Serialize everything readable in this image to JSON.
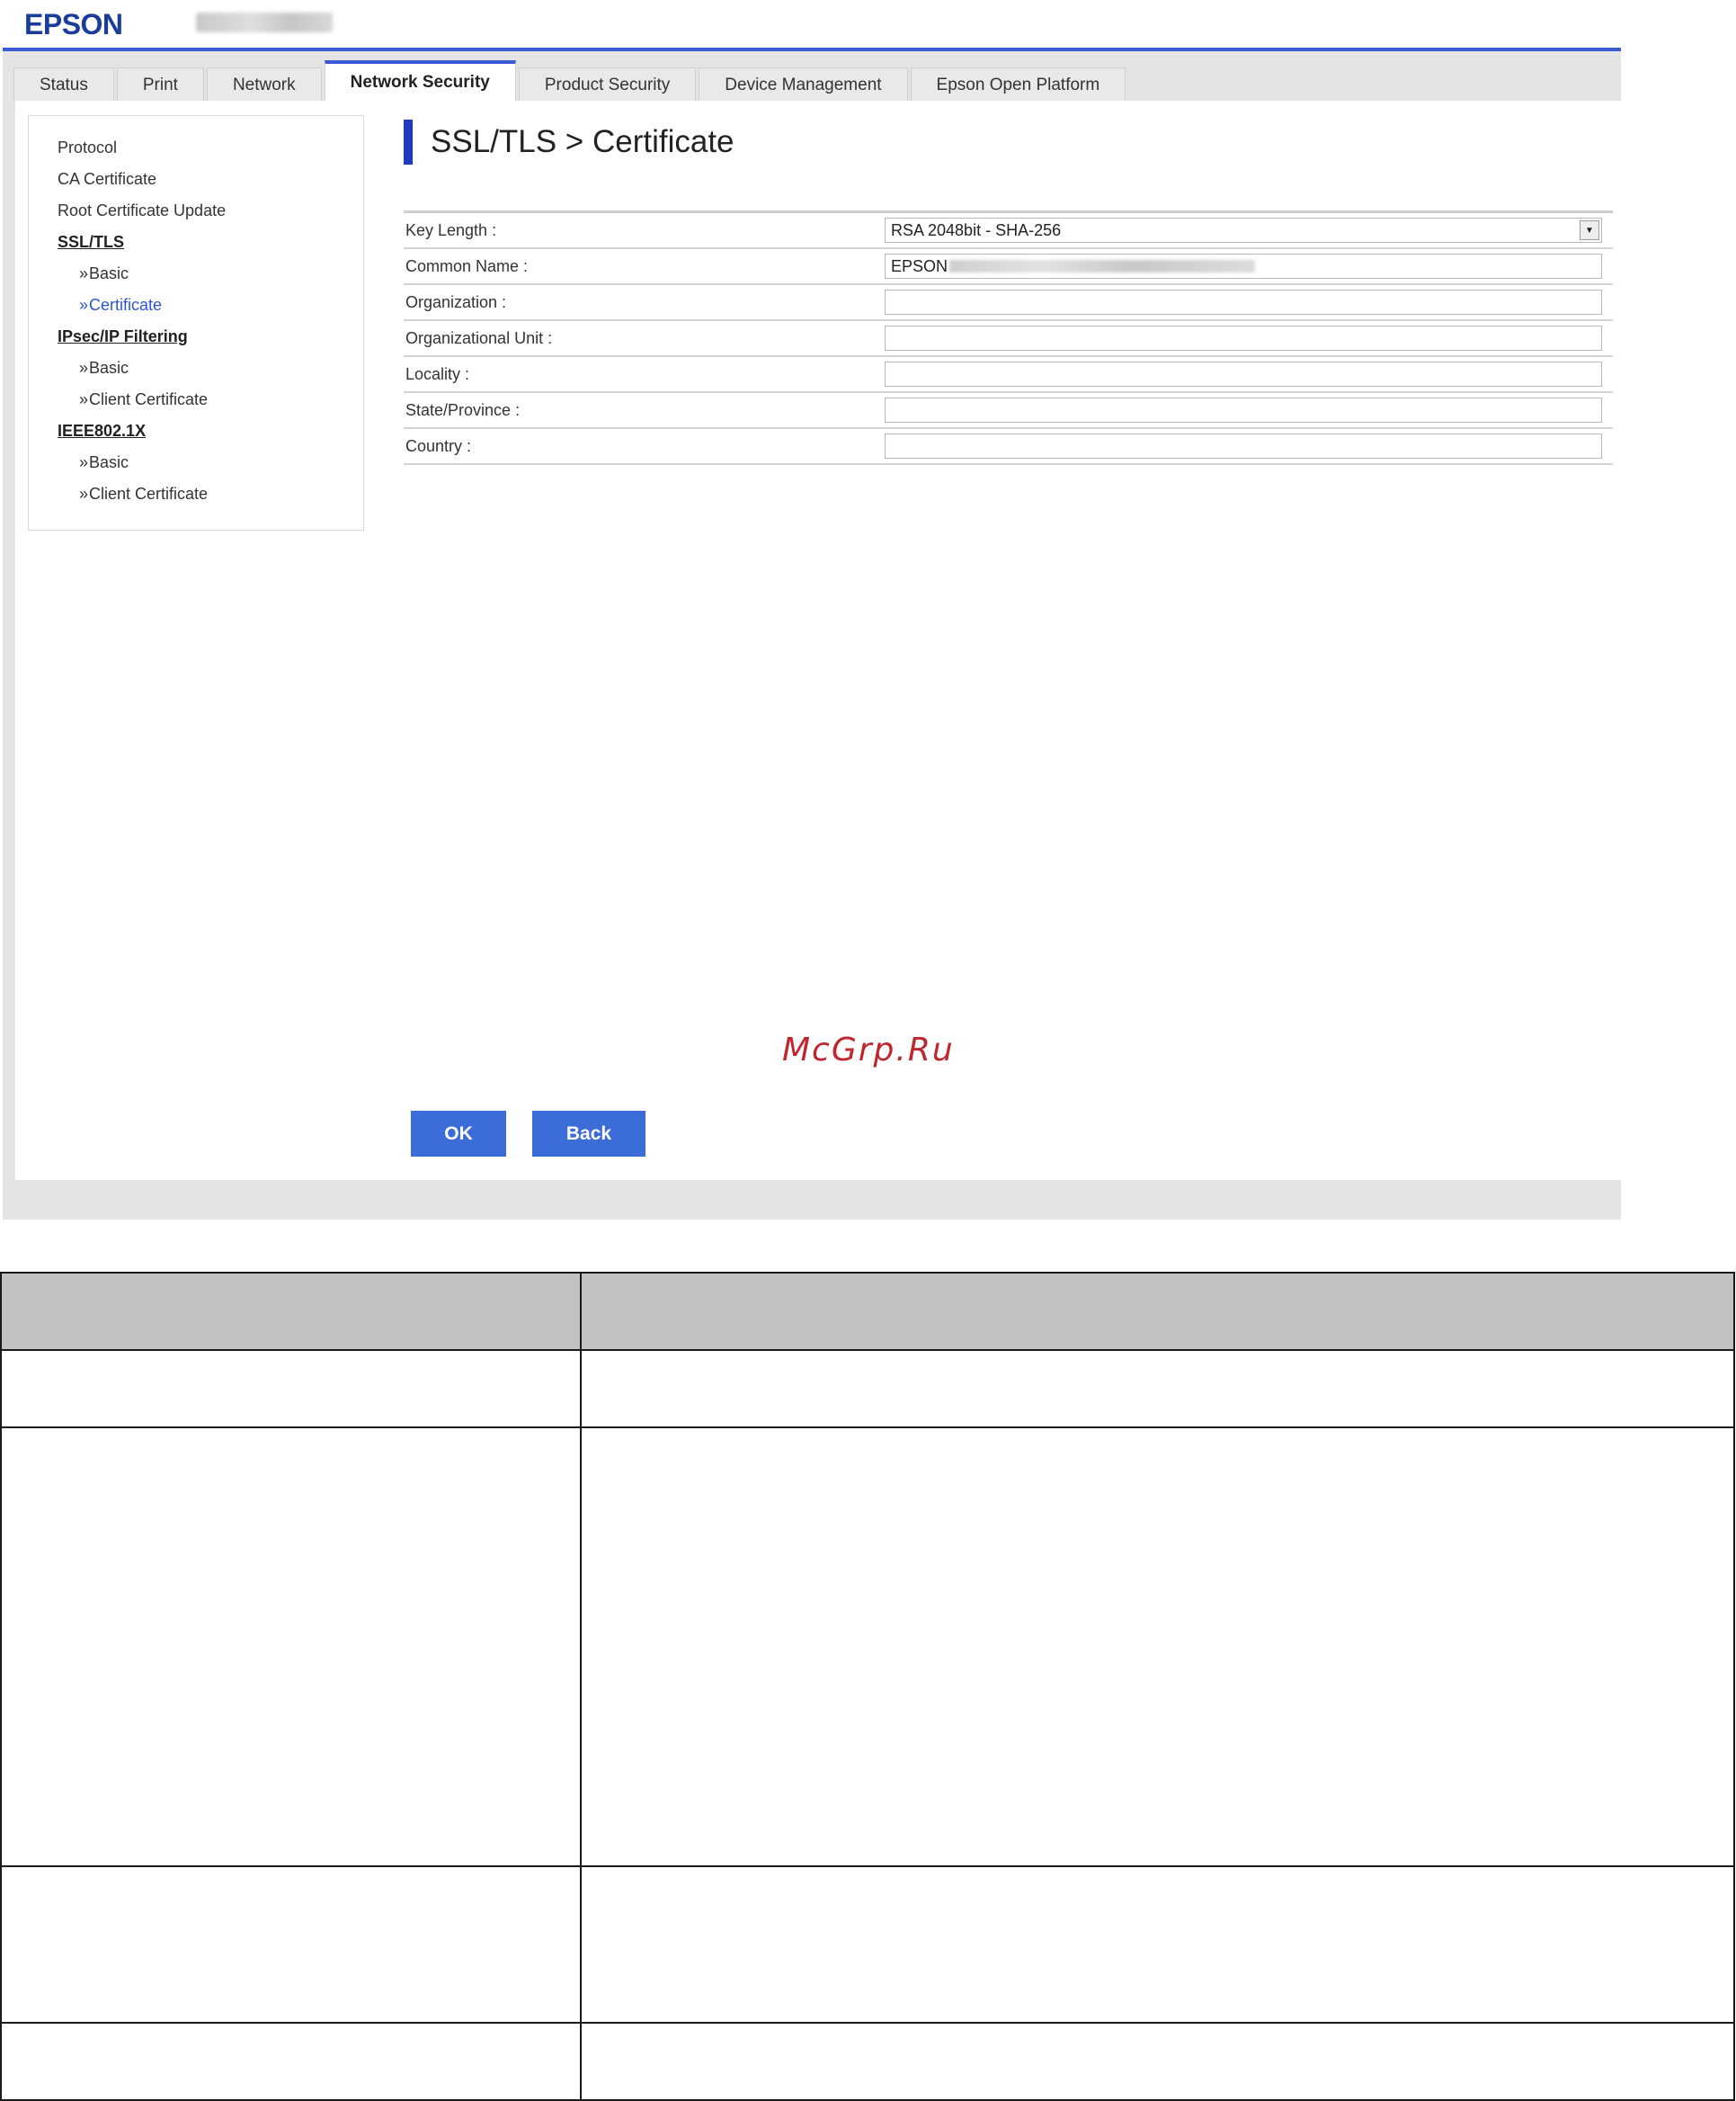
{
  "header": {
    "brand": "EPSON"
  },
  "tabs": [
    {
      "label": "Status",
      "active": false
    },
    {
      "label": "Print",
      "active": false
    },
    {
      "label": "Network",
      "active": false
    },
    {
      "label": "Network Security",
      "active": true
    },
    {
      "label": "Product Security",
      "active": false
    },
    {
      "label": "Device Management",
      "active": false
    },
    {
      "label": "Epson Open Platform",
      "active": false
    }
  ],
  "sidebar": {
    "items": [
      {
        "label": "Protocol"
      },
      {
        "label": "CA Certificate"
      },
      {
        "label": "Root Certificate Update"
      },
      {
        "label": "SSL/TLS"
      },
      {
        "label": "Basic"
      },
      {
        "label": "Certificate"
      },
      {
        "label": "IPsec/IP Filtering"
      },
      {
        "label": "Basic"
      },
      {
        "label": "Client Certificate"
      },
      {
        "label": "IEEE802.1X"
      },
      {
        "label": "Basic"
      },
      {
        "label": "Client Certificate"
      }
    ]
  },
  "page": {
    "title": "SSL/TLS > Certificate"
  },
  "form": {
    "key_length": {
      "label": "Key Length :",
      "value": "RSA 2048bit - SHA-256"
    },
    "common_name": {
      "label": "Common Name :",
      "value": "EPSON"
    },
    "organization": {
      "label": "Organization :",
      "value": ""
    },
    "organizational_unit": {
      "label": "Organizational Unit :",
      "value": ""
    },
    "locality": {
      "label": "Locality :",
      "value": ""
    },
    "state_province": {
      "label": "State/Province :",
      "value": ""
    },
    "country": {
      "label": "Country :",
      "value": ""
    }
  },
  "buttons": {
    "ok": "OK",
    "back": "Back"
  },
  "watermark": "McGrp.Ru",
  "colors": {
    "accent": "#3b5bd6",
    "button": "#3b6cd8",
    "title_bar": "#2038c8",
    "brand": "#1a3d9a",
    "watermark": "#c0262d",
    "table_header": "#c2c2c2"
  }
}
